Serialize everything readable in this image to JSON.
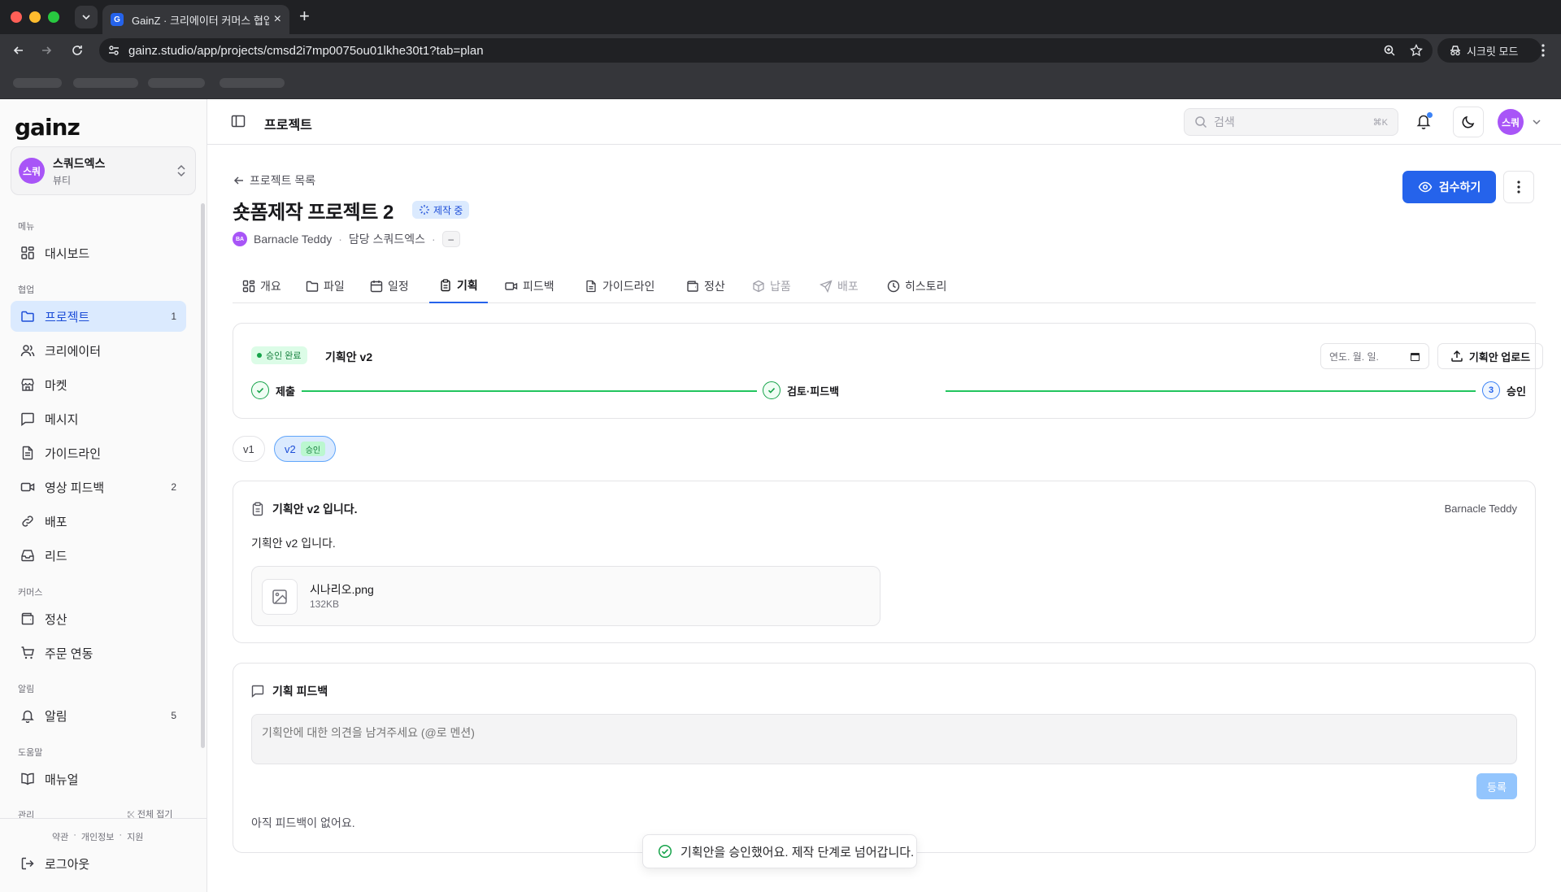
{
  "browser": {
    "tab_title": "GainZ · 크리에이터 커머스 협업 C",
    "favicon_letter": "G",
    "url": "gainz.studio/app/projects/cmsd2i7mp0075ou01lkhe30t1?tab=plan",
    "incognito_label": "시크릿 모드"
  },
  "sidebar": {
    "logo": "gainz",
    "org": {
      "avatar": "스쿼",
      "name": "스쿼드엑스",
      "category": "뷰티"
    },
    "sections": {
      "menu": "메뉴",
      "collab": "협업",
      "commerce": "커머스",
      "alerts": "알림",
      "help": "도움말",
      "admin": "관리"
    },
    "items": {
      "dashboard": "대시보드",
      "projects": "프로젝트",
      "projects_count": "1",
      "creators": "크리에이터",
      "market": "마켓",
      "messages": "메시지",
      "guidelines": "가이드라인",
      "video_feedback": "영상 피드백",
      "video_feedback_count": "2",
      "distribution": "배포",
      "leads": "리드",
      "settlement": "정산",
      "order_sync": "주문 연동",
      "notifications": "알림",
      "notifications_count": "5",
      "manual": "매뉴얼"
    },
    "collapse_all": "전체 접기",
    "footer_links": [
      "약관",
      "·",
      "개인정보",
      "·",
      "지원"
    ],
    "logout": "로그아웃"
  },
  "topbar": {
    "title": "프로젝트",
    "search_placeholder": "검색",
    "search_shortcut": "⌘K",
    "user_avatar": "스쿼"
  },
  "project": {
    "back_label": "프로젝트 목록",
    "title": "숏폼제작 프로젝트 2",
    "status": "제작 중",
    "creator_initials": "BA",
    "creator": "Barnacle Teddy",
    "manager": "담당 스쿼드엑스",
    "sep": "·",
    "dash": "–",
    "review_button": "검수하기"
  },
  "tabs": [
    {
      "label": "개요",
      "icon": "layout-icon"
    },
    {
      "label": "파일",
      "icon": "folder-icon"
    },
    {
      "label": "일정",
      "icon": "calendar-icon"
    },
    {
      "label": "기획",
      "icon": "clipboard-icon"
    },
    {
      "label": "피드백",
      "icon": "video-icon"
    },
    {
      "label": "가이드라인",
      "icon": "document-icon"
    },
    {
      "label": "정산",
      "icon": "wallet-icon"
    },
    {
      "label": "납품",
      "icon": "package-icon"
    },
    {
      "label": "배포",
      "icon": "send-icon"
    },
    {
      "label": "히스토리",
      "icon": "clock-icon"
    }
  ],
  "plan": {
    "approved_badge": "승인 완료",
    "name": "기획안 v2",
    "date_placeholder": "연도. 월. 일.",
    "upload_button": "기획안 업로드",
    "steps": [
      "제출",
      "검토·피드백",
      "승인"
    ],
    "step3_number": "3",
    "versions": {
      "v1": "v1",
      "v2": "v2",
      "v2_tag": "승인"
    },
    "doc_title": "기획안 v2 입니다.",
    "doc_author": "Barnacle Teddy",
    "doc_body": "기획안 v2 입니다.",
    "file_name": "시나리오.png",
    "file_size": "132KB"
  },
  "feedback": {
    "title": "기획 피드백",
    "placeholder": "기획안에 대한 의견을 남겨주세요 (@로 멘션)",
    "submit": "등록",
    "empty": "아직 피드백이 없어요."
  },
  "toast": "기획안을 승인했어요. 제작 단계로 넘어갑니다.",
  "colors": {
    "primary": "#2563eb",
    "active_bg": "#dbeafe",
    "success": "#16a34a"
  }
}
